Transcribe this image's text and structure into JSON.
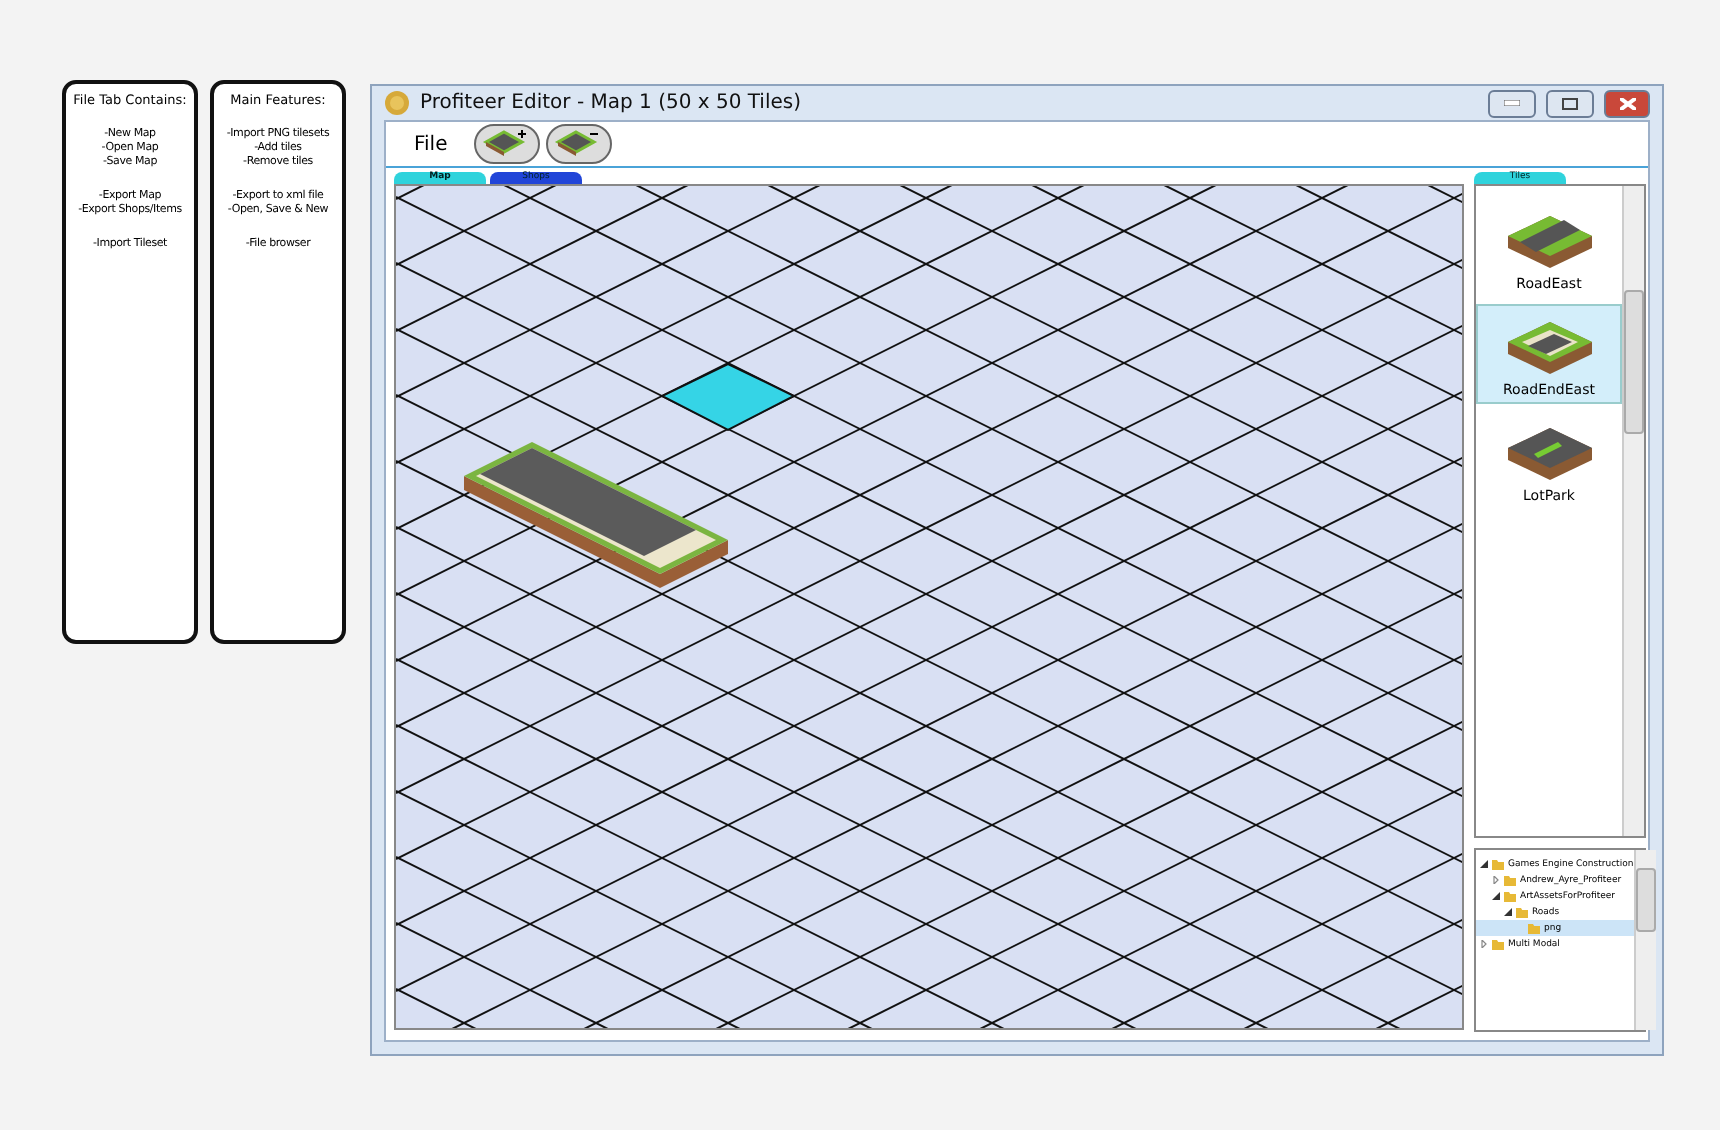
{
  "notes": [
    {
      "title": "File Tab Contains:",
      "groups": [
        [
          "-New Map",
          "-Open Map",
          "-Save Map"
        ],
        [
          "-Export Map",
          "-Export Shops/Items"
        ],
        [
          "-Import Tileset"
        ]
      ]
    },
    {
      "title": "Main Features:",
      "groups": [
        [
          "-Import PNG tilesets",
          "-Add tiles",
          "-Remove tiles"
        ],
        [
          "-Export to xml file",
          "-Open, Save & New"
        ],
        [
          "-File browser"
        ]
      ]
    }
  ],
  "window": {
    "title": "Profiteer Editor  - Map 1 (50 x 50 Tiles)"
  },
  "menu": {
    "label": "File"
  },
  "map_tabs": [
    {
      "label": "Map",
      "selected": true,
      "color": "#2fd3dc"
    },
    {
      "label": "Shops",
      "selected": false,
      "color": "#2145d8"
    }
  ],
  "tiles_tab": {
    "label": "Tiles"
  },
  "tiles": [
    {
      "name": "RoadEast",
      "kind": "road",
      "selected": false
    },
    {
      "name": "RoadEndEast",
      "kind": "roadend",
      "selected": true
    },
    {
      "name": "LotPark",
      "kind": "park",
      "selected": false
    }
  ],
  "tree": [
    {
      "label": "Games Engine Construction",
      "expanded": true,
      "selected": false,
      "children": [
        {
          "label": "Andrew_Ayre_Profiteer",
          "expanded": false,
          "selected": false
        },
        {
          "label": "ArtAssetsForProfiteer",
          "expanded": true,
          "selected": false,
          "children": [
            {
              "label": "Roads",
              "expanded": true,
              "selected": false,
              "children": [
                {
                  "label": "png",
                  "selected": true
                }
              ]
            }
          ]
        }
      ]
    },
    {
      "label": "Multi Modal",
      "expanded": false,
      "selected": false
    }
  ]
}
